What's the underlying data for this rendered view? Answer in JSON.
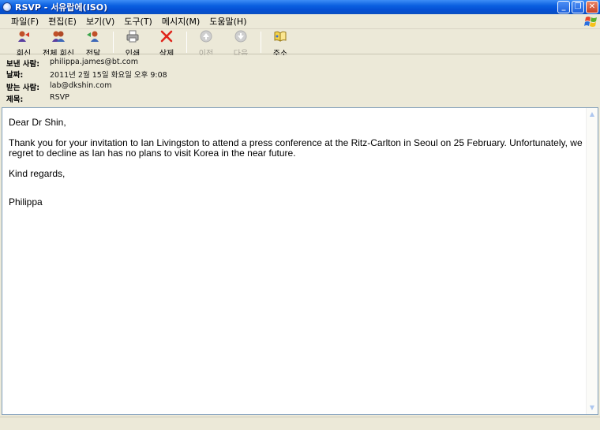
{
  "window": {
    "title": "RSVP - 서유랍에(ISO)"
  },
  "menu": [
    {
      "label": "파일(F)"
    },
    {
      "label": "편집(E)"
    },
    {
      "label": "보기(V)"
    },
    {
      "label": "도구(T)"
    },
    {
      "label": "메시지(M)"
    },
    {
      "label": "도움말(H)"
    }
  ],
  "toolbar": {
    "reply": "회신",
    "reply_all": "전체 회신",
    "forward": "전달",
    "print": "인쇄",
    "delete": "삭제",
    "previous": "이전",
    "next": "다음",
    "addresses": "주소"
  },
  "header": {
    "from_label": "보낸 사람:",
    "from": "philippa.james@bt.com",
    "date_label": "날짜:",
    "date": "2011년 2월 15일 화요일 오후 9:08",
    "to_label": "받는 사람:",
    "to": "lab@dkshin.com",
    "subject_label": "제목:",
    "subject": "RSVP"
  },
  "message": {
    "greeting": "Dear Dr Shin,",
    "paragraph1": "Thank you for your invitation to Ian Livingston to attend a press conference at the Ritz-Carlton in Seoul on 25 February.  Unfortunately, we regret to decline as Ian has no plans to visit Korea in the near future.",
    "closing": "Kind regards,",
    "signature": "Philippa"
  },
  "colors": {
    "titlebar": "#0a5fe0",
    "delete_x": "#e0251b"
  }
}
